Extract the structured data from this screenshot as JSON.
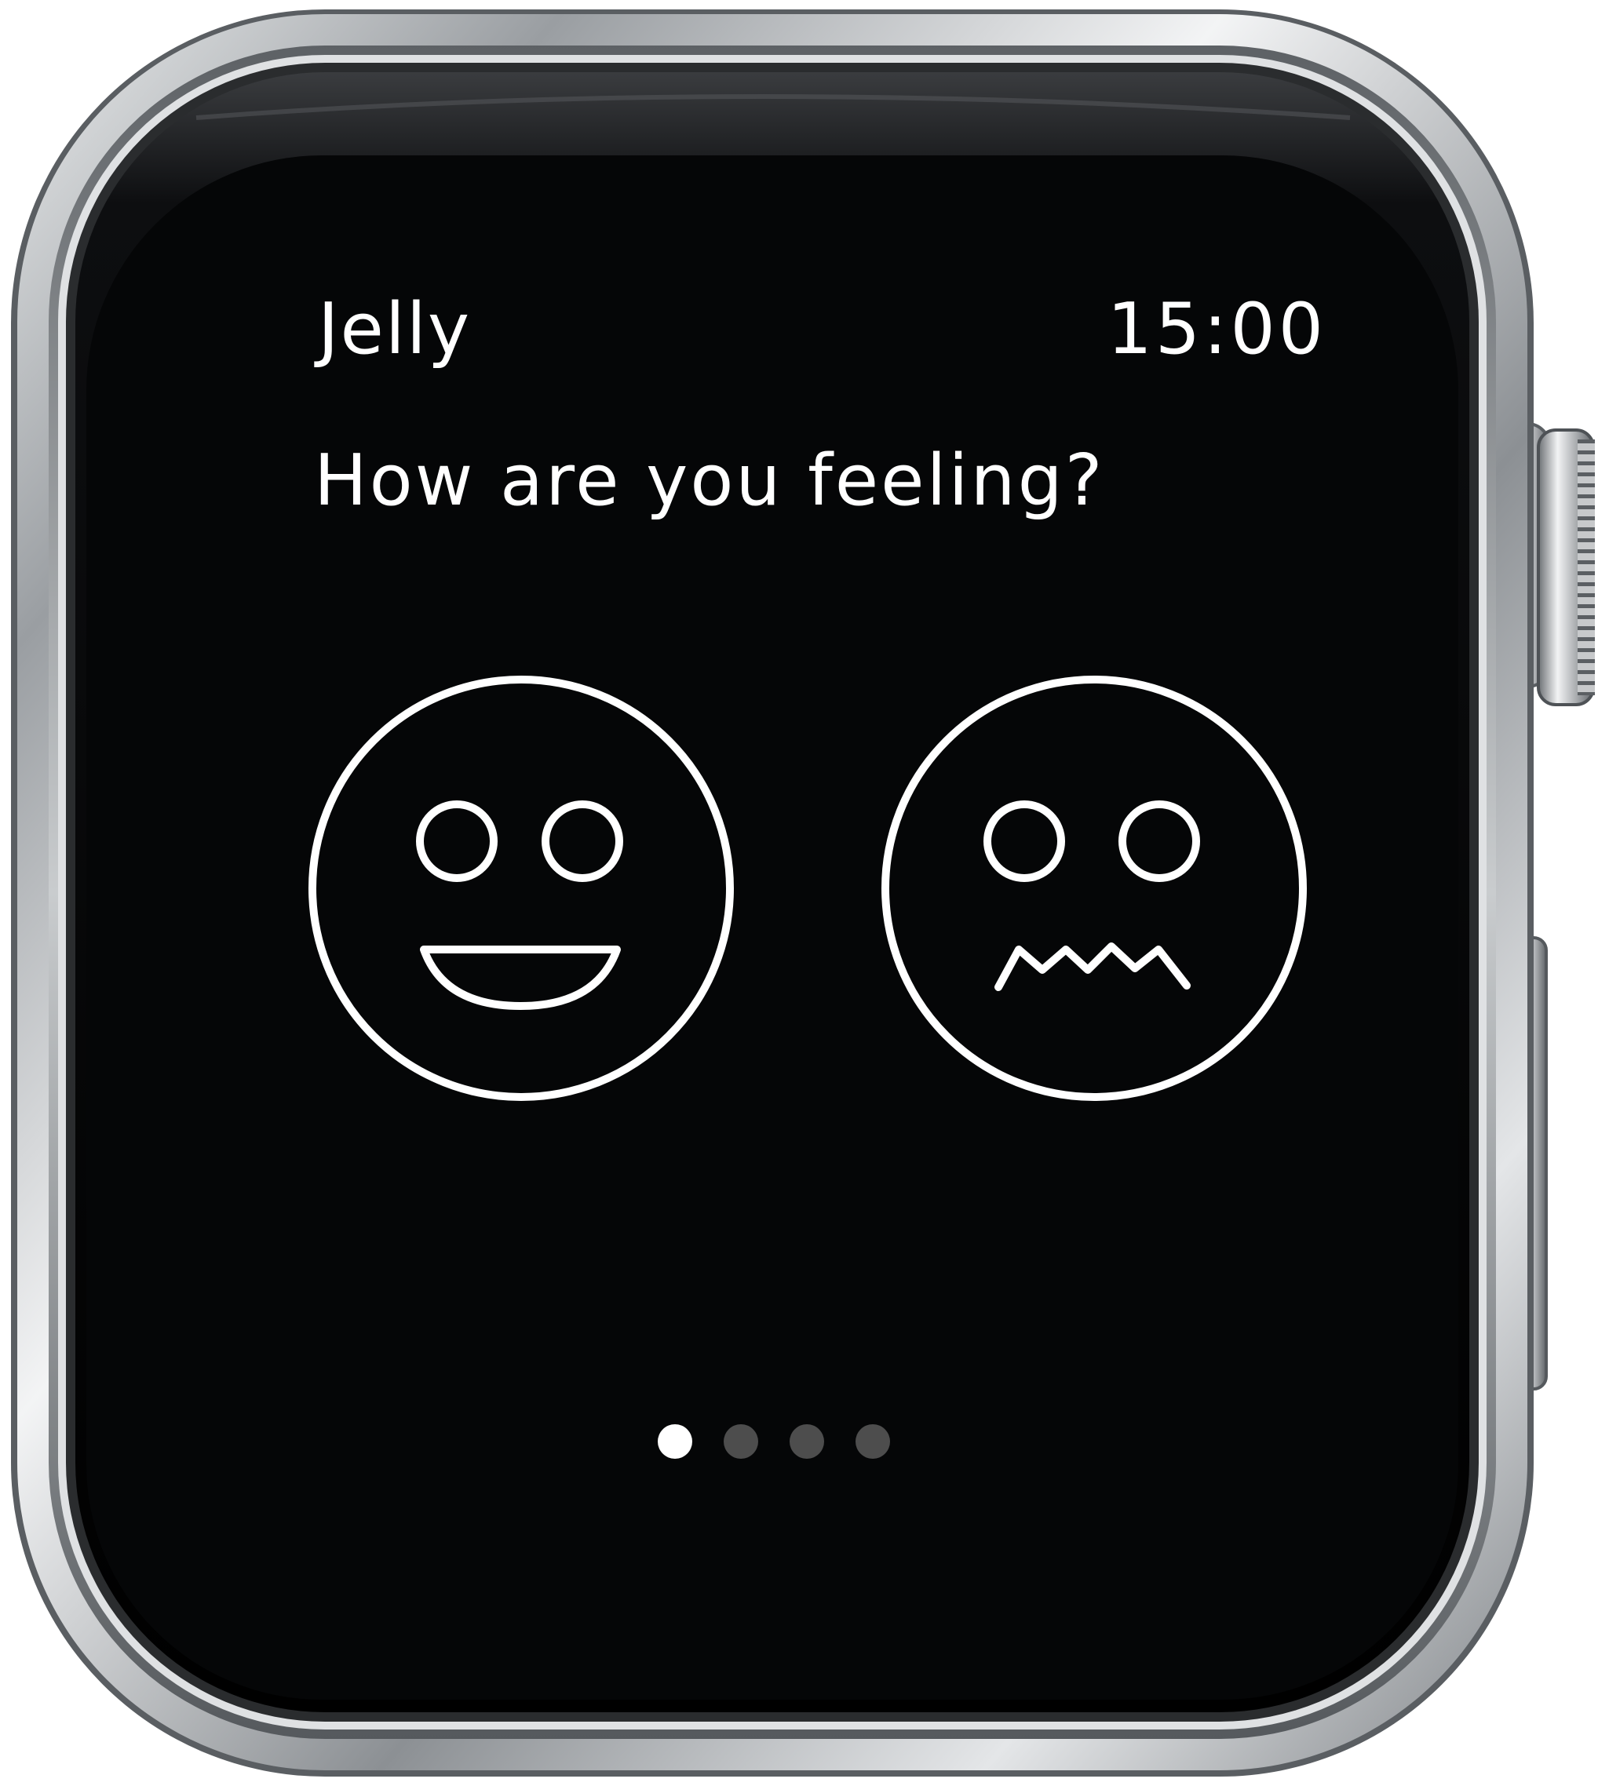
{
  "header": {
    "app_name": "Jelly",
    "time": "15:00"
  },
  "prompt": {
    "question": "How are you feeling?"
  },
  "moods": [
    {
      "icon": "happy-face-icon"
    },
    {
      "icon": "upset-face-icon"
    }
  ],
  "pagination": {
    "total_pages": 4,
    "active_page": 1,
    "active_color": "#ffffff",
    "inactive_color": "#4d4d4d"
  },
  "colors": {
    "screen_background": "#050607",
    "foreground": "#ffffff",
    "case_steel": "#b9bcbf"
  }
}
